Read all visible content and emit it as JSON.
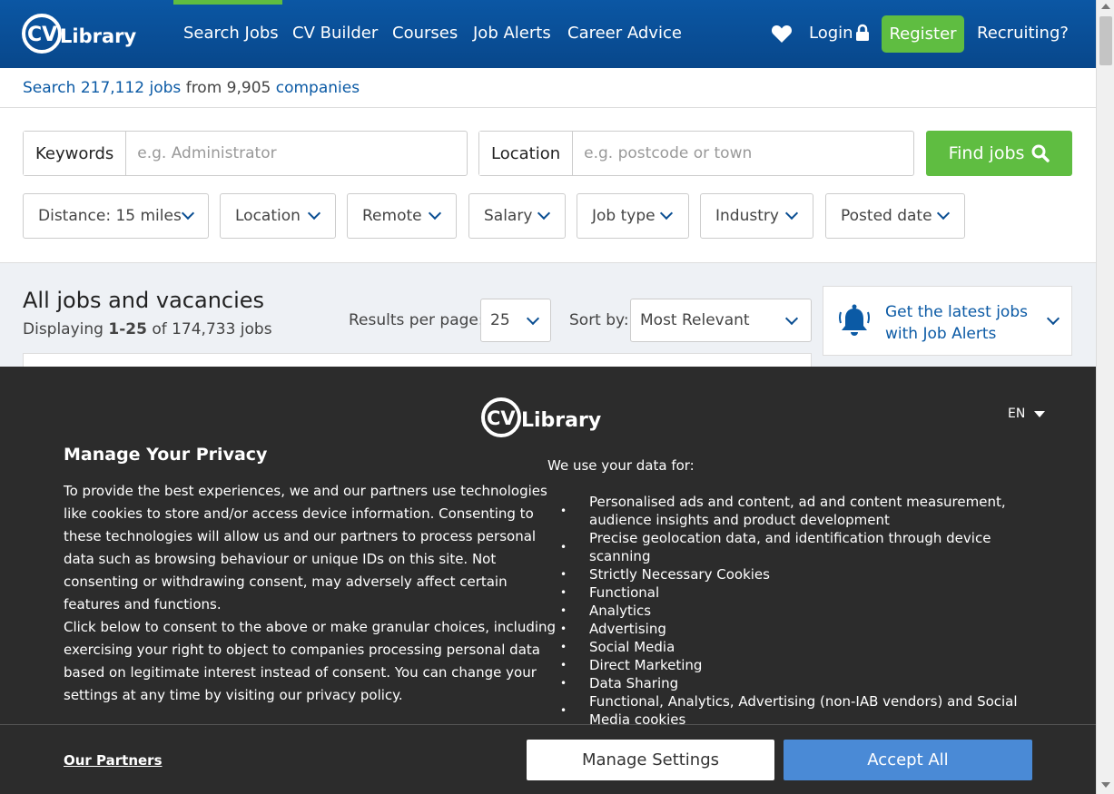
{
  "header": {
    "logo_text": "CV Library",
    "nav": [
      "Search Jobs",
      "CV Builder",
      "Courses",
      "Job Alerts",
      "Career Advice"
    ],
    "login": "Login",
    "register": "Register",
    "recruiting": "Recruiting?"
  },
  "stats": {
    "search_prefix": "Search",
    "jobs_count": "217,112 jobs",
    "from_text": "from 9,905",
    "companies": "companies"
  },
  "search": {
    "keywords_label": "Keywords",
    "keywords_placeholder": "e.g. Administrator",
    "location_label": "Location",
    "location_placeholder": "e.g. postcode or town",
    "find_button": "Find jobs"
  },
  "filters": [
    "Distance: 15 miles",
    "Location",
    "Remote",
    "Salary",
    "Job type",
    "Industry",
    "Posted date"
  ],
  "results": {
    "title": "All jobs and vacancies",
    "displaying_prefix": "Displaying",
    "range": "1-25",
    "of_text": "of 174,733 jobs",
    "per_page_label": "Results per page:",
    "per_page_value": "25",
    "sort_label": "Sort by:",
    "sort_value": "Most Relevant",
    "alert_text": "Get the latest jobs with Job Alerts"
  },
  "privacy": {
    "logo_text": "CV Library",
    "language": "EN",
    "title": "Manage Your Privacy",
    "body_1": "To provide the best experiences, we and our partners use technologies like cookies to store and/or access device information. Consenting to these technologies will allow us and our partners to process personal data such as browsing behaviour or unique IDs on this site. Not consenting or withdrawing consent, may adversely affect certain features and functions.",
    "body_2": "Click below to consent to the above or make granular choices, including exercising your right to object to companies processing personal data based on legitimate interest instead of consent. You can change your settings at any time by visiting our privacy policy.",
    "uses_title": "We use your data for:",
    "uses": [
      "Personalised ads and content, ad and content measurement, audience insights and product development",
      "Precise geolocation data, and identification through device scanning",
      "Strictly Necessary Cookies",
      "Functional",
      "Analytics",
      "Advertising",
      "Social Media",
      "Direct Marketing",
      "Data Sharing",
      "Functional, Analytics, Advertising (non-IAB vendors) and Social Media cookies"
    ],
    "partners_link": "Our Partners",
    "manage_button": "Manage Settings",
    "accept_button": "Accept All"
  },
  "colors": {
    "header_blue": "#0b57a4",
    "brand_green": "#5fbd41",
    "link_blue": "#0b5aa5",
    "overlay_bg": "#2c2c2c",
    "accept_blue": "#4a8ad6"
  }
}
